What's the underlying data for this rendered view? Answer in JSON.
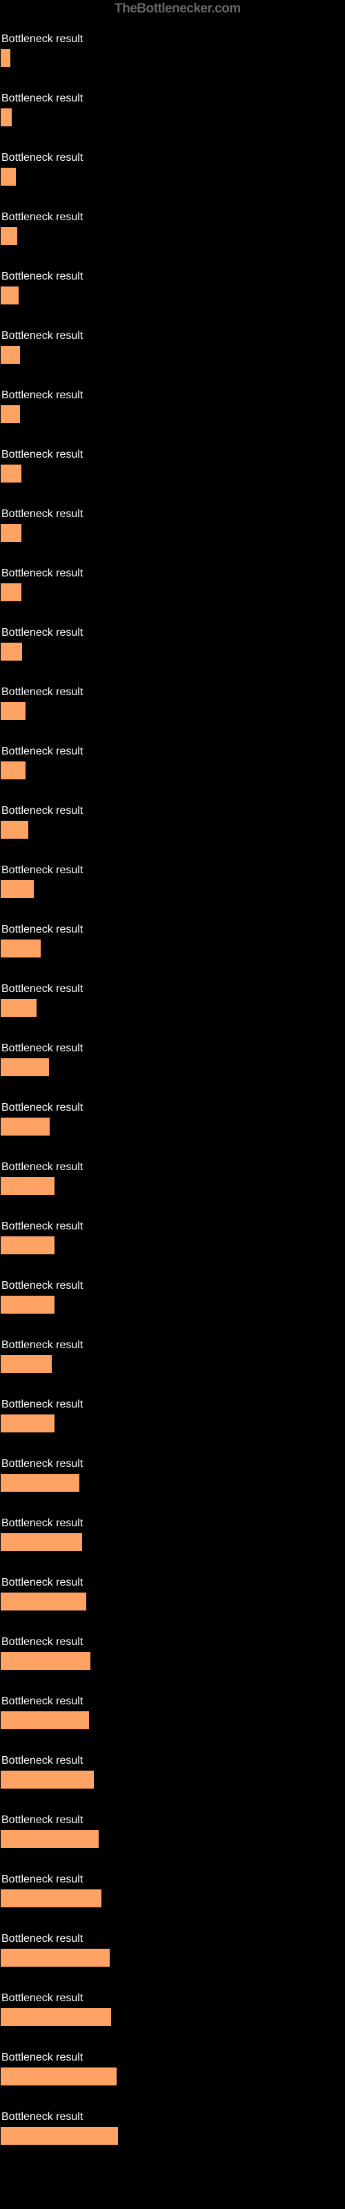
{
  "watermark": "TheBottlenecker.com",
  "chart_data": {
    "type": "bar",
    "title": "",
    "xlabel": "",
    "ylabel": "",
    "categories": [
      "Bottleneck result",
      "Bottleneck result",
      "Bottleneck result",
      "Bottleneck result",
      "Bottleneck result",
      "Bottleneck result",
      "Bottleneck result",
      "Bottleneck result",
      "Bottleneck result",
      "Bottleneck result",
      "Bottleneck result",
      "Bottleneck result",
      "Bottleneck result",
      "Bottleneck result",
      "Bottleneck result",
      "Bottleneck result",
      "Bottleneck result",
      "Bottleneck result",
      "Bottleneck result",
      "Bottleneck result",
      "Bottleneck result",
      "Bottleneck result",
      "Bottleneck result",
      "Bottleneck result",
      "Bottleneck result",
      "Bottleneck result",
      "Bottleneck result",
      "Bottleneck result",
      "Bottleneck result",
      "Bottleneck result",
      "Bottleneck result",
      "Bottleneck result",
      "Bottleneck result",
      "Bottleneck result",
      "Bottleneck result",
      "Bottleneck result"
    ],
    "values": [
      16,
      18,
      24,
      26,
      28,
      30,
      30,
      32,
      32,
      32,
      33,
      38,
      38,
      42,
      50,
      60,
      54,
      72,
      73,
      80,
      80,
      80,
      76,
      80,
      116,
      120,
      126,
      132,
      130,
      137,
      144,
      148,
      160,
      162,
      170,
      172
    ],
    "xlim": [
      0,
      500
    ]
  }
}
